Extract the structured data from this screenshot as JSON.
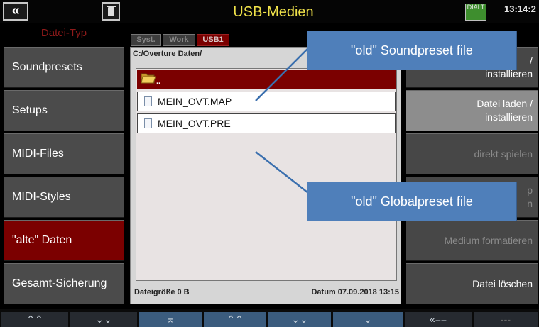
{
  "header": {
    "title": "USB-Medien",
    "clock": "13:14:2",
    "back_icon": "«",
    "status_icon_text": "DIALT"
  },
  "left": {
    "heading": "Datei-Typ",
    "items": [
      {
        "label": "Soundpresets"
      },
      {
        "label": "Setups"
      },
      {
        "label": "MIDI-Files"
      },
      {
        "label": "MIDI-Styles"
      },
      {
        "label": "\"alte\" Daten"
      },
      {
        "label": "Gesamt-Sicherung"
      }
    ]
  },
  "browser": {
    "tabs": [
      "Syst.",
      "Work",
      "USB1"
    ],
    "path": "C:/Overture Daten/",
    "parent_entry": "..",
    "files": [
      "MEIN_OVT.MAP",
      "MEIN_OVT.PRE"
    ],
    "size": "Dateigröße 0 B",
    "date": "Datum 07.09.2018   13:15"
  },
  "right": {
    "items": [
      {
        "line1": "/",
        "line2": "installieren"
      },
      {
        "line1": "Datei laden  /",
        "line2": "installieren"
      },
      {
        "line1": "direkt spielen",
        "line2": ""
      },
      {
        "line1": "p",
        "line2": "n"
      },
      {
        "line1": "Medium formatieren",
        "line2": ""
      },
      {
        "line1": "Datei löschen",
        "line2": ""
      }
    ]
  },
  "callouts": {
    "sound": "\"old\" Soundpreset file",
    "global": "\"old\" Globalpreset file"
  },
  "bottom": {
    "buttons": [
      "⌃⌃",
      "⌄⌄",
      "⌅",
      "⌃⌃",
      "⌄⌄",
      "⌄",
      "«==",
      "---"
    ]
  }
}
